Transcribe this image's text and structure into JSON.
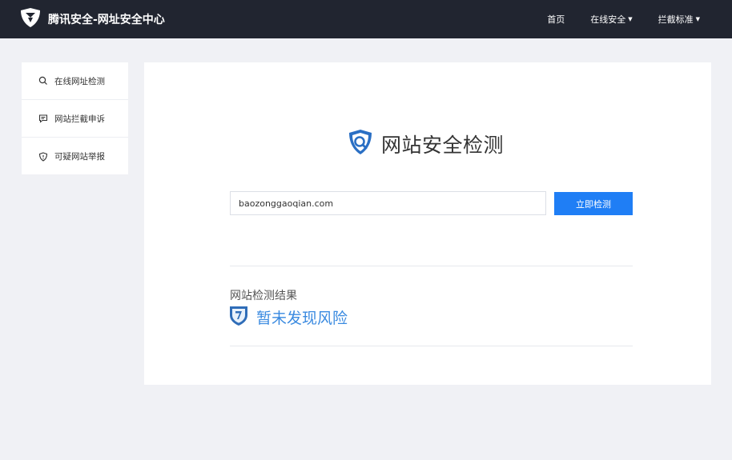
{
  "header": {
    "brand_title": "腾讯安全-网址安全中心",
    "nav": [
      {
        "label": "首页"
      },
      {
        "label": "在线安全"
      },
      {
        "label": "拦截标准"
      }
    ]
  },
  "sidebar": {
    "items": [
      {
        "label": "在线网址检测",
        "icon": "search-icon"
      },
      {
        "label": "网站拦截申诉",
        "icon": "message-icon"
      },
      {
        "label": "可疑网站举报",
        "icon": "shield-alert-icon"
      }
    ]
  },
  "main": {
    "heading": "网站安全检测",
    "search": {
      "value": "baozonggaoqian.com",
      "button_label": "立即检测"
    },
    "result": {
      "label": "网站检测结果",
      "status": "暂未发现风险"
    }
  },
  "colors": {
    "header_bg": "#212530",
    "accent": "#1f7ef5",
    "status": "#3a8ae0"
  }
}
